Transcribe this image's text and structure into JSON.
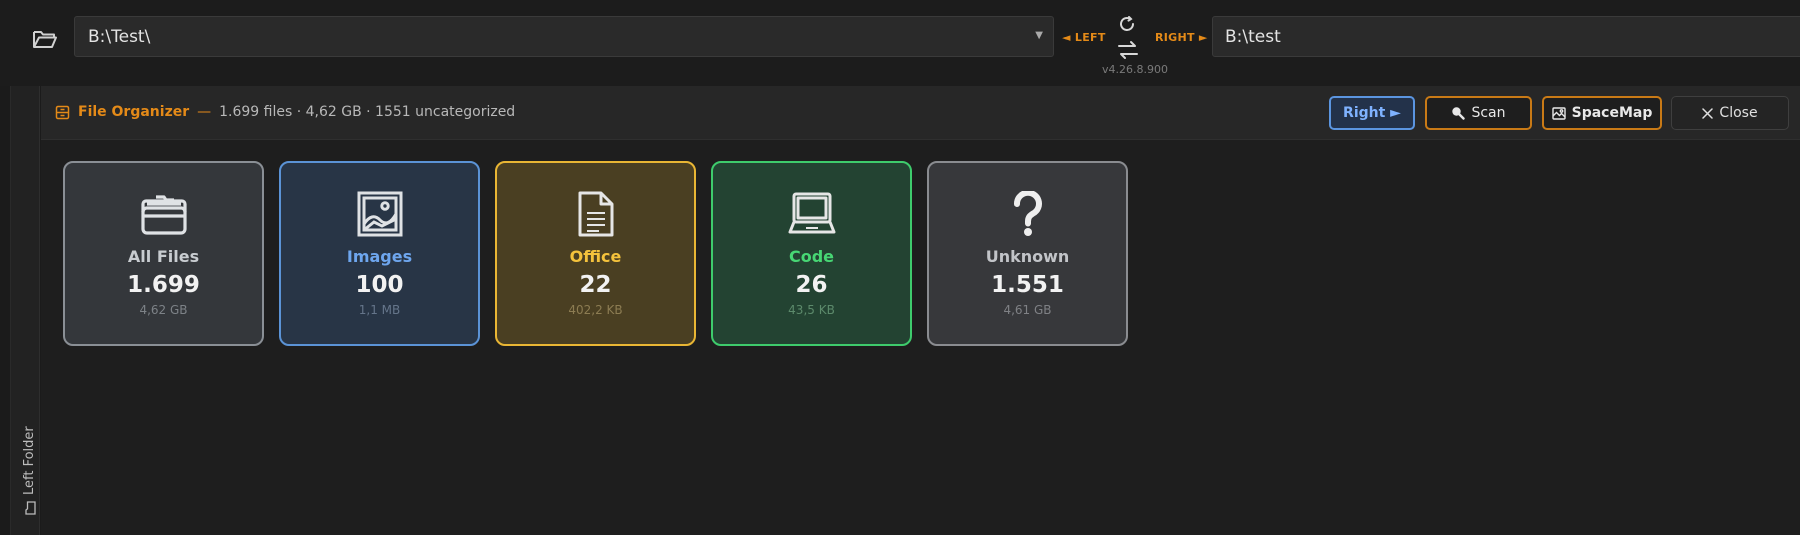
{
  "toolbar": {
    "left_path": "B:\\Test\\",
    "right_path": "B:\\test",
    "left_label": "◄ LEFT",
    "right_label": "RIGHT ►",
    "version": "v4.26.8.900"
  },
  "left_strip": {
    "label": "Left Folder"
  },
  "organizer": {
    "title": "File Organizer",
    "separator": "—",
    "summary": "1.699 files · 4,62 GB · 1551 uncategorized",
    "buttons": {
      "right": "Right ►",
      "scan": "Scan",
      "spacemap": "SpaceMap",
      "close": "Close"
    }
  },
  "categories": [
    {
      "label": "All Files",
      "count": "1.699",
      "size": "4,62 GB",
      "icon": "folder-icon"
    },
    {
      "label": "Images",
      "count": "100",
      "size": "1,1 MB",
      "icon": "image-icon"
    },
    {
      "label": "Office",
      "count": "22",
      "size": "402,2 KB",
      "icon": "document-icon"
    },
    {
      "label": "Code",
      "count": "26",
      "size": "43,5 KB",
      "icon": "laptop-icon"
    },
    {
      "label": "Unknown",
      "count": "1.551",
      "size": "4,61 GB",
      "icon": "question-icon"
    }
  ],
  "colors": {
    "accent_orange": "#e48a18",
    "images_blue": "#5b93d6",
    "office_yellow": "#e9b634",
    "code_green": "#3ecb6c",
    "neutral_gray": "#8a8f95"
  }
}
